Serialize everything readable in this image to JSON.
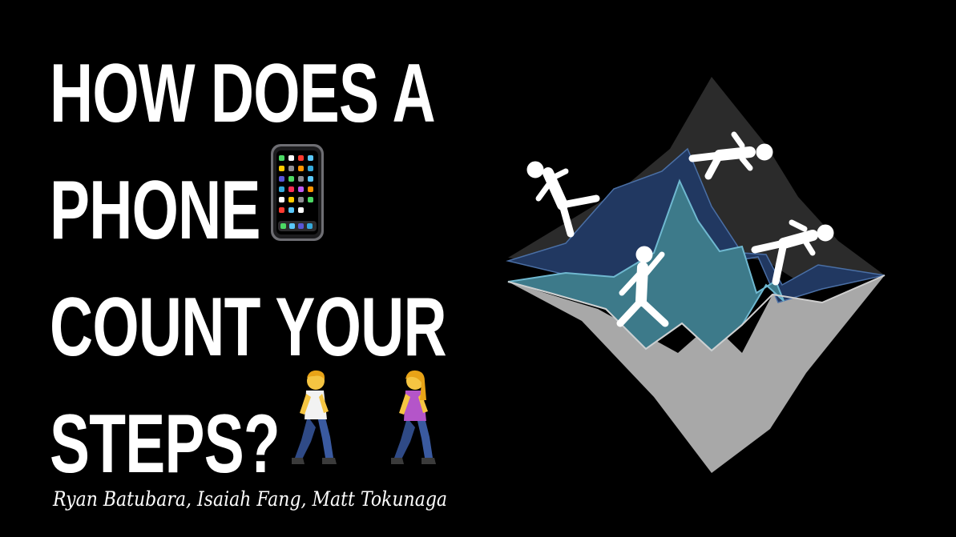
{
  "slide": {
    "title_lines": [
      "HOW DOES A",
      "PHONE",
      "COUNT YOUR",
      "STEPS?"
    ],
    "authors": "Ryan Batubara, Isaiah Fang, Matt Tokunaga",
    "icons": {
      "phone": "mobile-phone-emoji",
      "man_walking": "man-walking-emoji",
      "woman_walking": "woman-walking-emoji",
      "illustration": "mountain-with-runners-illustration"
    },
    "colors": {
      "background": "#000000",
      "text": "#ffffff",
      "layer_dark": "#2b2b2b",
      "layer_navy": "#213861",
      "layer_teal": "#3d7a8a",
      "layer_gray": "#a8a8a8"
    }
  }
}
